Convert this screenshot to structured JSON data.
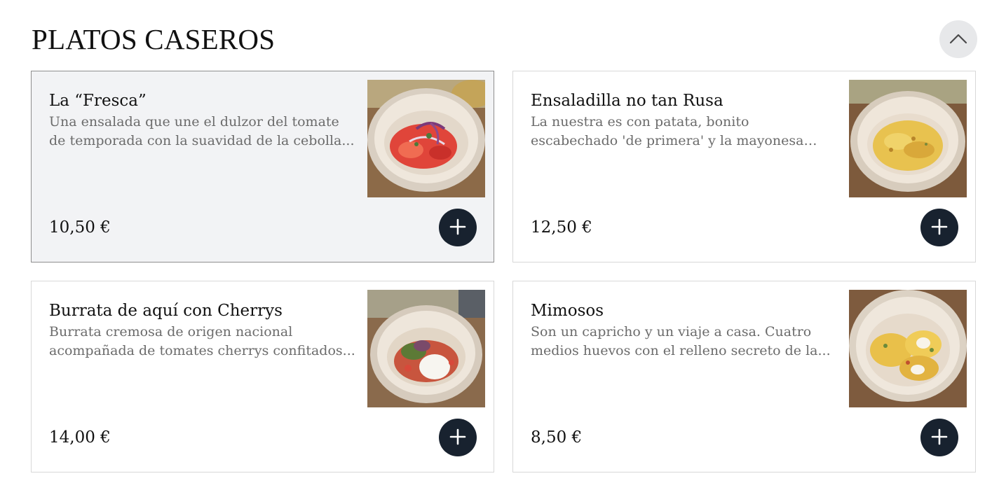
{
  "section": {
    "title": "PLATOS CASEROS"
  },
  "icons": {
    "collapse": "chevron-up-icon",
    "add": "plus-icon"
  },
  "colors": {
    "add_button": "#18222f",
    "collapse_button": "#e7e8ea",
    "selected_card": "#f2f3f5"
  },
  "dishes": [
    {
      "name": "La “Fresca”",
      "description": "Una ensalada que une el dulzor del tomate de temporada con la suavidad de la cebolla...",
      "price": "10,50 €",
      "selected": true
    },
    {
      "name": "Ensaladilla no tan Rusa",
      "description": "La nuestra es con patata, bonito escabechado 'de primera' y la mayonesa casera de AOVE ...",
      "price": "12,50 €",
      "selected": false
    },
    {
      "name": "Burrata de aquí con Cherrys",
      "description": "Burrata cremosa de origen nacional acompañada de tomates cherrys confitados...",
      "price": "14,00 €",
      "selected": false
    },
    {
      "name": "Mimosos",
      "description": "Son un capricho y un viaje a casa. Cuatro medios huevos con el relleno secreto de la...",
      "price": "8,50 €",
      "selected": false
    }
  ]
}
